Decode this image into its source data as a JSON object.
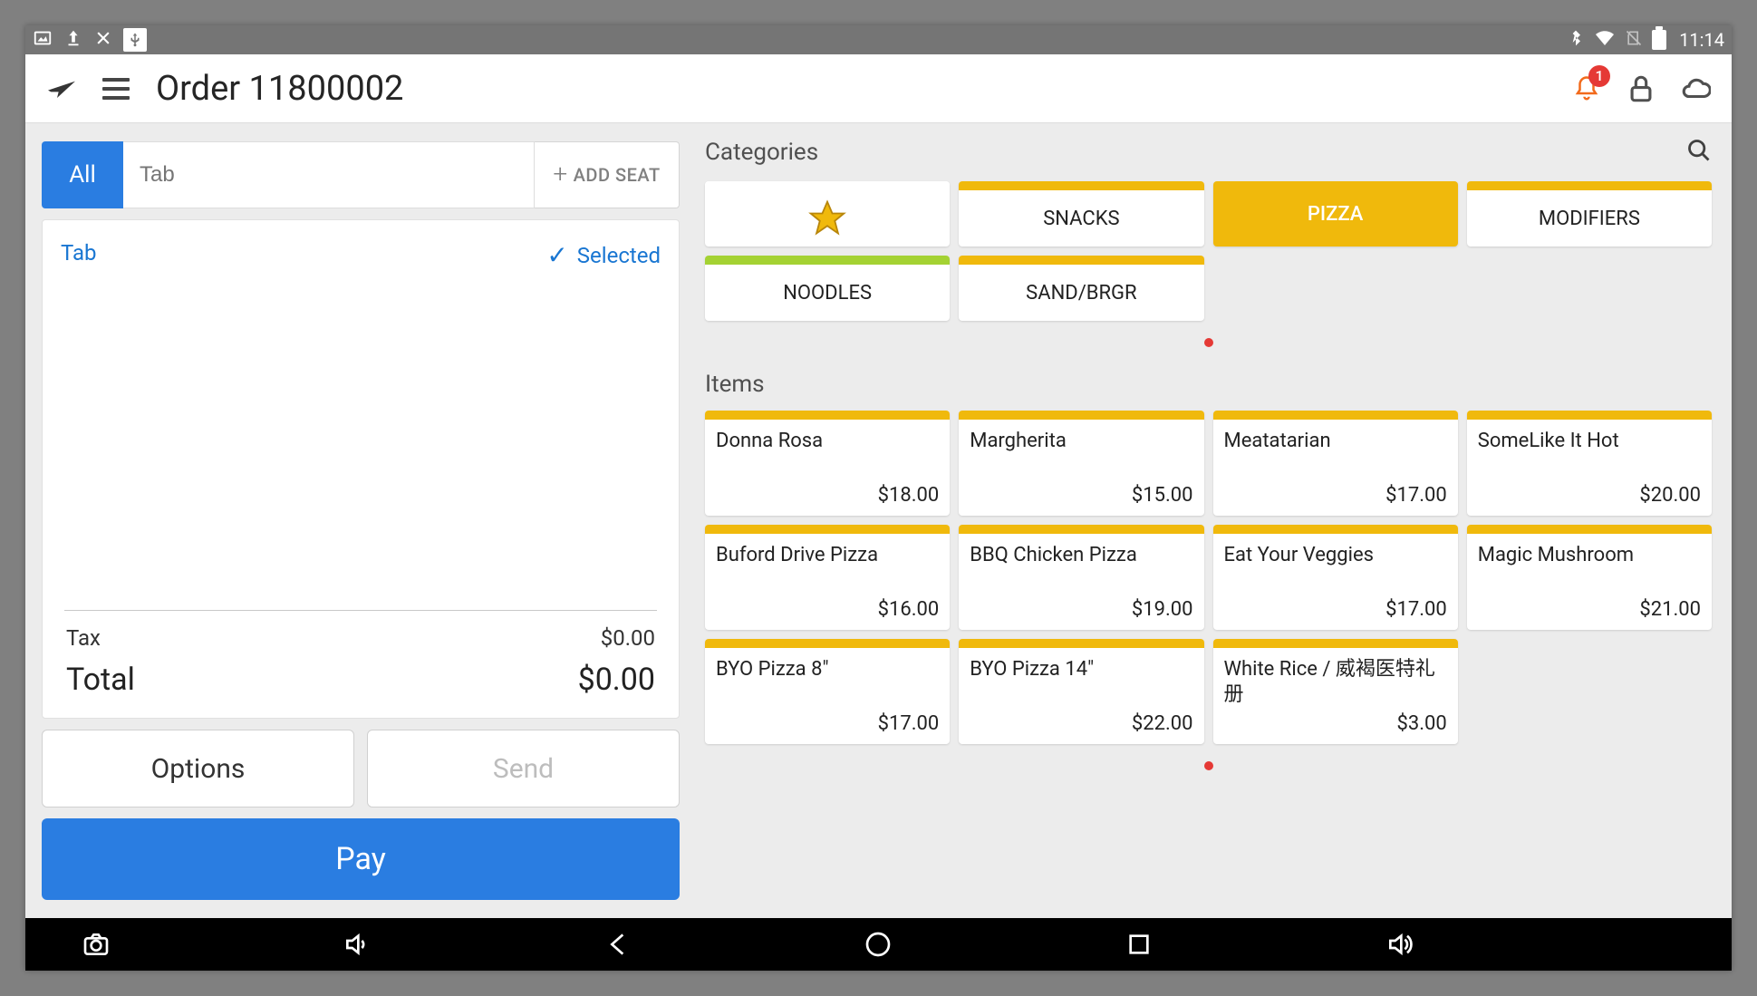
{
  "status": {
    "time": "11:14"
  },
  "header": {
    "title": "Order 11800002",
    "badge": "1"
  },
  "leftPanel": {
    "allTab": "All",
    "tabPlaceholder": "Tab",
    "addSeat": "ADD SEAT",
    "tabLabel": "Tab",
    "selectedLabel": "Selected",
    "taxLabel": "Tax",
    "taxValue": "$0.00",
    "totalLabel": "Total",
    "totalValue": "$0.00",
    "optionsLabel": "Options",
    "sendLabel": "Send",
    "payLabel": "Pay"
  },
  "rightPanel": {
    "categoriesLabel": "Categories",
    "itemsLabel": "Items",
    "categories": [
      {
        "name": "",
        "stripe": "#ffffff",
        "star": true,
        "active": false
      },
      {
        "name": "SNACKS",
        "stripe": "#f0b90c",
        "active": false
      },
      {
        "name": "PIZZA",
        "stripe": "#f0b90c",
        "active": true
      },
      {
        "name": "MODIFIERS",
        "stripe": "#f0b90c",
        "active": false
      },
      {
        "name": "NOODLES",
        "stripe": "#a4d233",
        "active": false
      },
      {
        "name": "SAND/BRGR",
        "stripe": "#f0b90c",
        "active": false
      }
    ],
    "items": [
      {
        "name": "Donna Rosa",
        "price": "$18.00"
      },
      {
        "name": "Margherita",
        "price": "$15.00"
      },
      {
        "name": "Meatatarian",
        "price": "$17.00"
      },
      {
        "name": "SomeLike It Hot",
        "price": "$20.00"
      },
      {
        "name": "Buford Drive Pizza",
        "price": "$16.00"
      },
      {
        "name": "BBQ Chicken Pizza",
        "price": "$19.00"
      },
      {
        "name": "Eat Your Veggies",
        "price": "$17.00"
      },
      {
        "name": "Magic Mushroom",
        "price": "$21.00"
      },
      {
        "name": "BYO Pizza 8\"",
        "price": "$17.00"
      },
      {
        "name": "BYO Pizza 14\"",
        "price": "$22.00"
      },
      {
        "name": "White Rice / 威褐医特礼册",
        "price": "$3.00"
      }
    ]
  }
}
